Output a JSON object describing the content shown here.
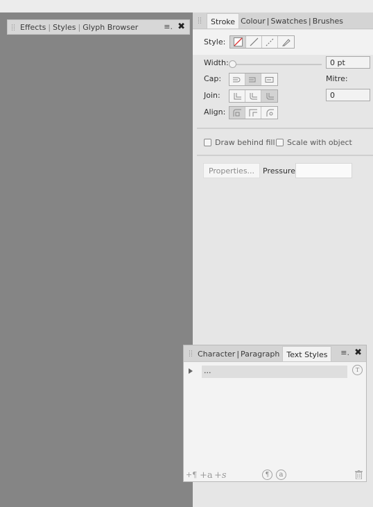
{
  "effects_panel": {
    "tabs": [
      "Effects",
      "Styles",
      "Glyph Browser"
    ],
    "menu_glyph": "≡.",
    "close_glyph": "✖"
  },
  "stroke_panel": {
    "tabs": [
      "Stroke",
      "Colour",
      "Swatches",
      "Brushes"
    ],
    "style_label": "Style:",
    "width_label": "Width:",
    "width_value": "0 pt",
    "cap_label": "Cap:",
    "mitre_label": "Mitre:",
    "mitre_value": "0",
    "join_label": "Join:",
    "align_label": "Align:",
    "draw_behind_fill": "Draw behind fill",
    "scale_with_object": "Scale with object",
    "properties_button": "Properties...",
    "pressure_label": "Pressure:",
    "width_slider_value": 0
  },
  "character_panel": {
    "tabs": [
      "Character",
      "Paragraph",
      "Text Styles"
    ],
    "menu_glyph": "≡.",
    "close_glyph": "✖",
    "style_item": "...",
    "bottom_icons": [
      "+¶",
      "+a",
      "+s",
      "¶",
      "a"
    ]
  },
  "colors": {
    "canvas": "#858585",
    "panel": "#e6e6e6",
    "tab_bar": "#d4d4d4"
  }
}
